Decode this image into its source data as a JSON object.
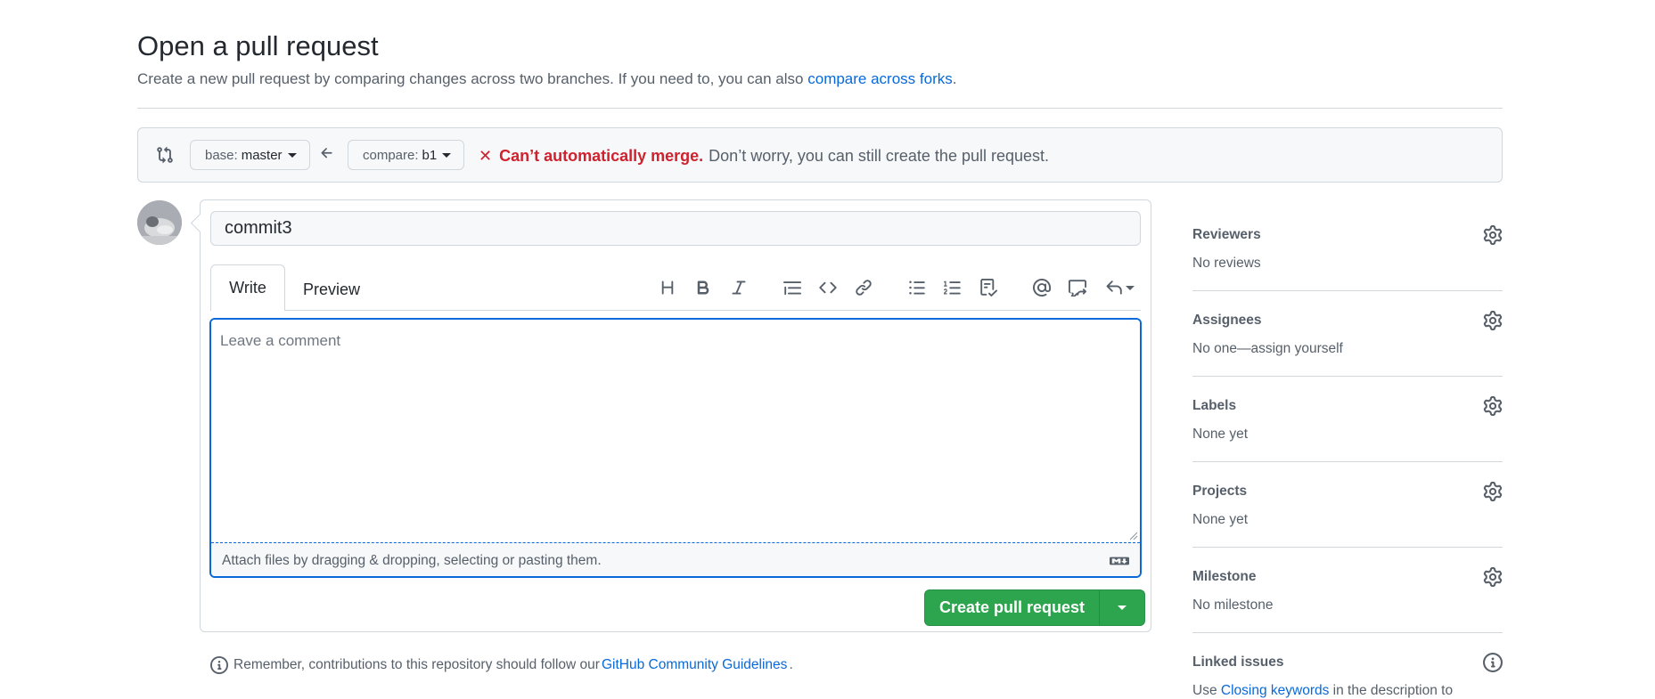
{
  "header": {
    "title": "Open a pull request",
    "subtitle_text": "Create a new pull request by comparing changes across two branches. If you need to, you can also",
    "subtitle_link": "compare across forks",
    "subtitle_end": "."
  },
  "compare": {
    "base_label": "base:",
    "base_value": "master",
    "compare_label": "compare:",
    "compare_value": "b1",
    "status_bad": "Can’t automatically merge.",
    "status_ok": "Don’t worry, you can still create the pull request."
  },
  "editor": {
    "title_value": "commit3",
    "tab_write": "Write",
    "tab_preview": "Preview",
    "comment_placeholder": "Leave a comment",
    "attach_text": "Attach files by dragging & dropping, selecting or pasting them.",
    "toolbar": [
      "heading-icon",
      "bold-icon",
      "italic-icon",
      "quote-icon",
      "code-icon",
      "link-icon",
      "unordered-list-icon",
      "ordered-list-icon",
      "task-list-icon",
      "mention-icon",
      "reference-icon",
      "reply-icon"
    ]
  },
  "actions": {
    "create_label": "Create pull request"
  },
  "footer": {
    "remember_text": "Remember, contributions to this repository should follow our",
    "guidelines_link": "GitHub Community Guidelines",
    "remember_end": "."
  },
  "sidebar": {
    "reviewers": {
      "title": "Reviewers",
      "value": "No reviews"
    },
    "assignees": {
      "title": "Assignees",
      "value": "No one—assign yourself"
    },
    "labels": {
      "title": "Labels",
      "value": "None yet"
    },
    "projects": {
      "title": "Projects",
      "value": "None yet"
    },
    "milestone": {
      "title": "Milestone",
      "value": "No milestone"
    },
    "linked_issues": {
      "title": "Linked issues",
      "value_prefix": "Use",
      "value_link": "Closing keywords",
      "value_suffix": "in the description to"
    }
  },
  "colors": {
    "accent": "#0969da",
    "danger": "#cf222e",
    "primary_button": "#2da44e",
    "border": "#d0d7de",
    "muted_text": "#57606a"
  }
}
